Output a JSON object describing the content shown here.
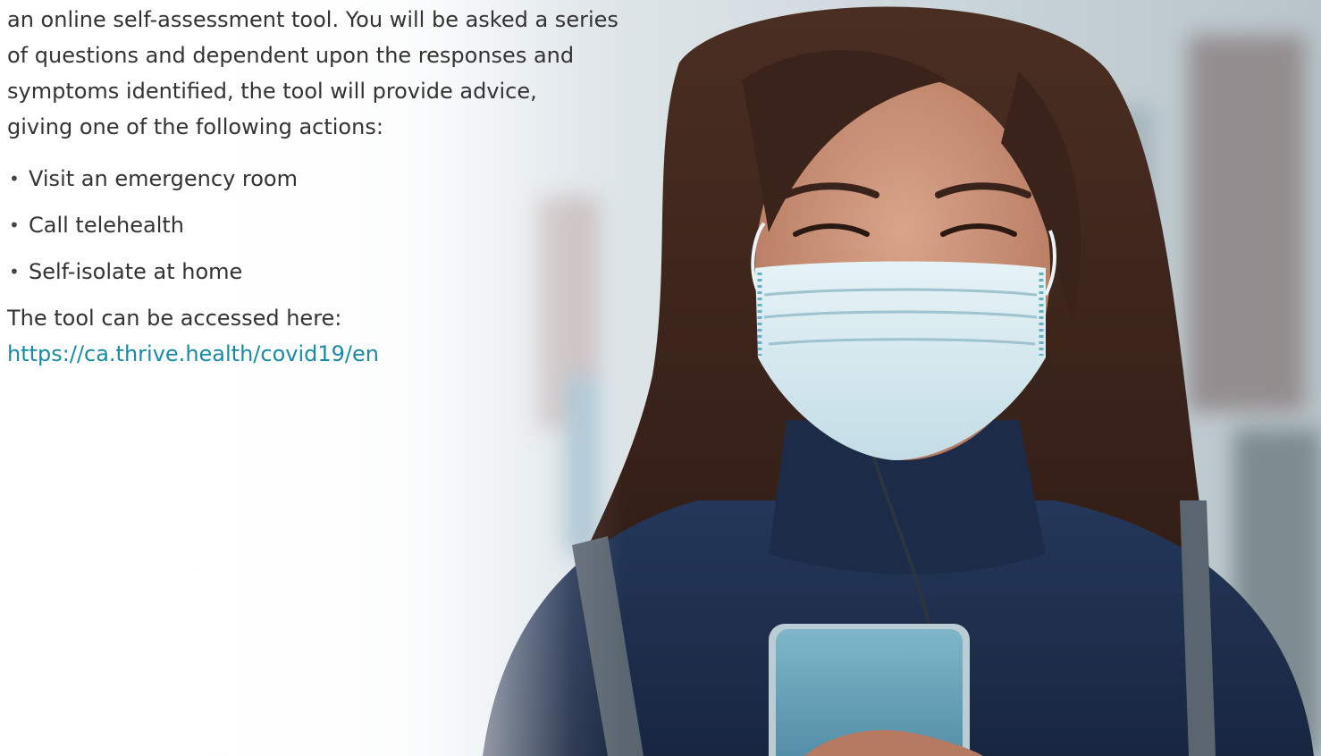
{
  "intro": {
    "lines": [
      "an online self-assessment tool. You will be asked a series",
      "of questions and dependent upon the responses and",
      "symptoms identified, the tool will provide advice,",
      "giving one of the following actions:"
    ]
  },
  "actions": [
    "Visit an emergency room",
    "Call telehealth",
    "Self-isolate at home"
  ],
  "access": {
    "label": "The tool can be accessed here:",
    "link_text": "https://ca.thrive.health/covid19/en"
  },
  "colors": {
    "text": "#333333",
    "link": "#1b8aa3",
    "coat": "#1e2f4d",
    "mask": "#d9eef3",
    "phone": "#6fa9c0"
  },
  "image": {
    "subject": "woman-wearing-face-mask-looking-at-phone"
  }
}
